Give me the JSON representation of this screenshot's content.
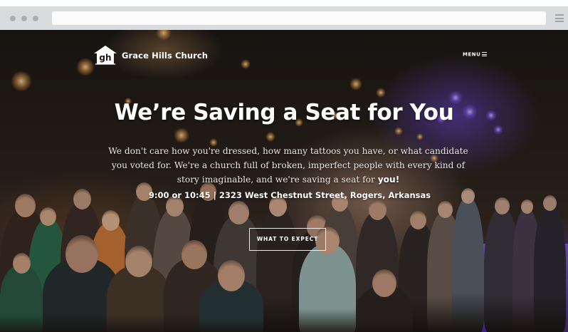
{
  "site": {
    "name": "Grace Hills Church",
    "logo_mark": "gh",
    "menu_label": "MENU"
  },
  "hero": {
    "headline": "We’re Saving a Seat for You",
    "tagline_main": "We don't care how you're dressed, how many tattoos you have, or what candidate you voted for. We're a church full of broken, imperfect people with every kind of story imaginable, and we're saving a seat for ",
    "tagline_emphasis": "you!",
    "service_info": "9:00 or 10:45 | 2323 West Chestnut Street, Rogers, Arkansas",
    "cta_label": "WHAT TO EXPECT"
  },
  "icons": {
    "logo": "church-logo-icon",
    "menu": "hamburger-icon",
    "browser_menu": "browser-menu-icon"
  },
  "colors": {
    "text": "#ffffff",
    "chrome": "#d8dcdf",
    "stage_light": "#7a50ff"
  }
}
